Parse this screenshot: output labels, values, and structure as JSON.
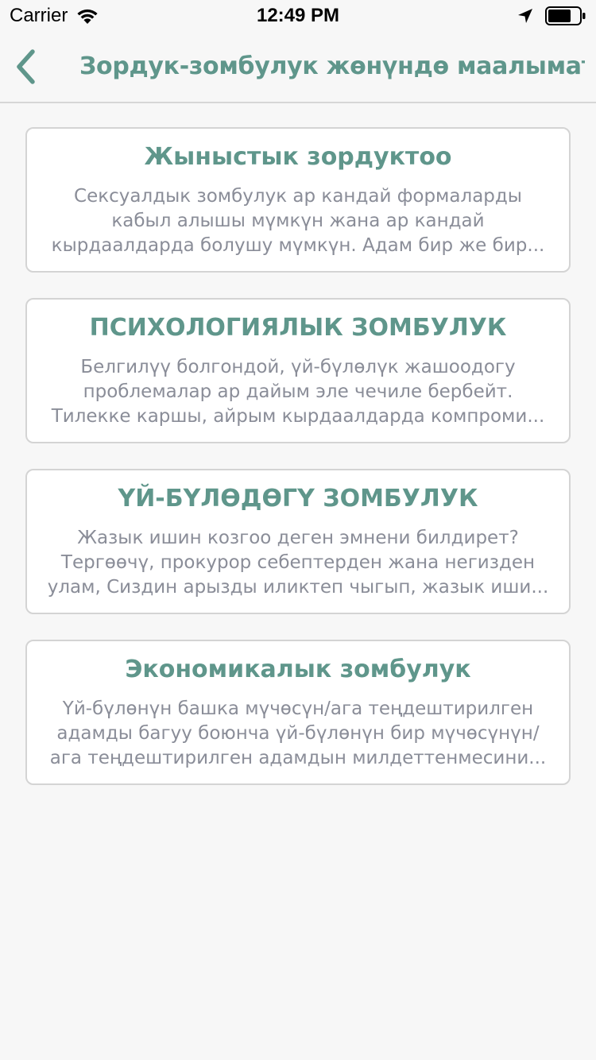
{
  "status_bar": {
    "carrier": "Carrier",
    "time": "12:49 PM",
    "icons": [
      "wifi-icon",
      "location-arrow-icon",
      "battery-icon"
    ]
  },
  "nav": {
    "back_icon": "chevron-left-icon",
    "title": "Зордук-зомбулук жөнүндө маалымат"
  },
  "colors": {
    "accent": "#5f968b",
    "body_text": "#8a8d98",
    "background": "#f7f7f7",
    "card_border": "#d4d4d4"
  },
  "cards": [
    {
      "title": "Жыныстык зордуктоо",
      "body": "Сексуалдык зомбулук ар кандай формаларды кабыл алышы мүмкүн жана ар кандай кырдаалдарда болушу мүмкүн. Адам бир же бир..."
    },
    {
      "title": "ПСИХОЛОГИЯЛЫК ЗОМБУЛУК",
      "body": "Белгилүү болгондой, үй-бүлөлүк жашоодогу проблемалар ар дайым эле чечиле бербейт. Тилекке каршы, айрым кырдаалдарда компроми..."
    },
    {
      "title": "ҮЙ-БҮЛӨДӨГҮ ЗОМБУЛУК",
      "body": "Жазык ишин козгоо деген эмнени билдирет? Тергөөчү, прокурор себептерден жана негизден улам,  Сиздин арызды иликтеп чыгып, жазык иши..."
    },
    {
      "title": "Экономикалык зомбулук",
      "body": "Үй-бүлөнүн башка мүчөсүн/ага теңдештирилген адамды багуу боюнча үй-бүлөнүн бир мүчөсүнүн/ага теңдештирилген адамдын милдеттенмесини..."
    }
  ]
}
